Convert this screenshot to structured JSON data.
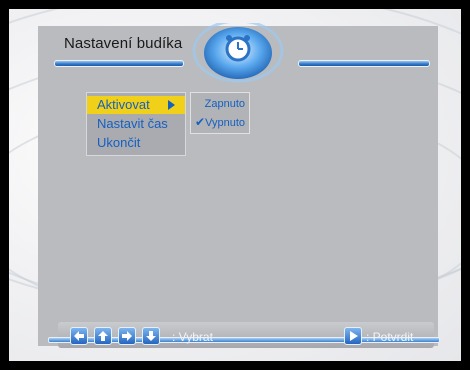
{
  "screen": {
    "title": "Nastavení budíka"
  },
  "menu": {
    "items": [
      {
        "label": "Aktivovat",
        "selected": true,
        "has_submenu": true
      },
      {
        "label": "Nastavit čas",
        "selected": false
      },
      {
        "label": "Ukončit",
        "selected": false
      }
    ]
  },
  "submenu": {
    "items": [
      {
        "label": "Zapnuto",
        "checked": false
      },
      {
        "label": "Vypnuto",
        "checked": true
      }
    ]
  },
  "footer": {
    "select_label": ": Vybrat",
    "confirm_label": ": Potvrdit"
  },
  "colors": {
    "accent_blue": "#2f78c6",
    "highlight_yellow": "#f0d018",
    "panel_gray": "#b9bbbf"
  }
}
